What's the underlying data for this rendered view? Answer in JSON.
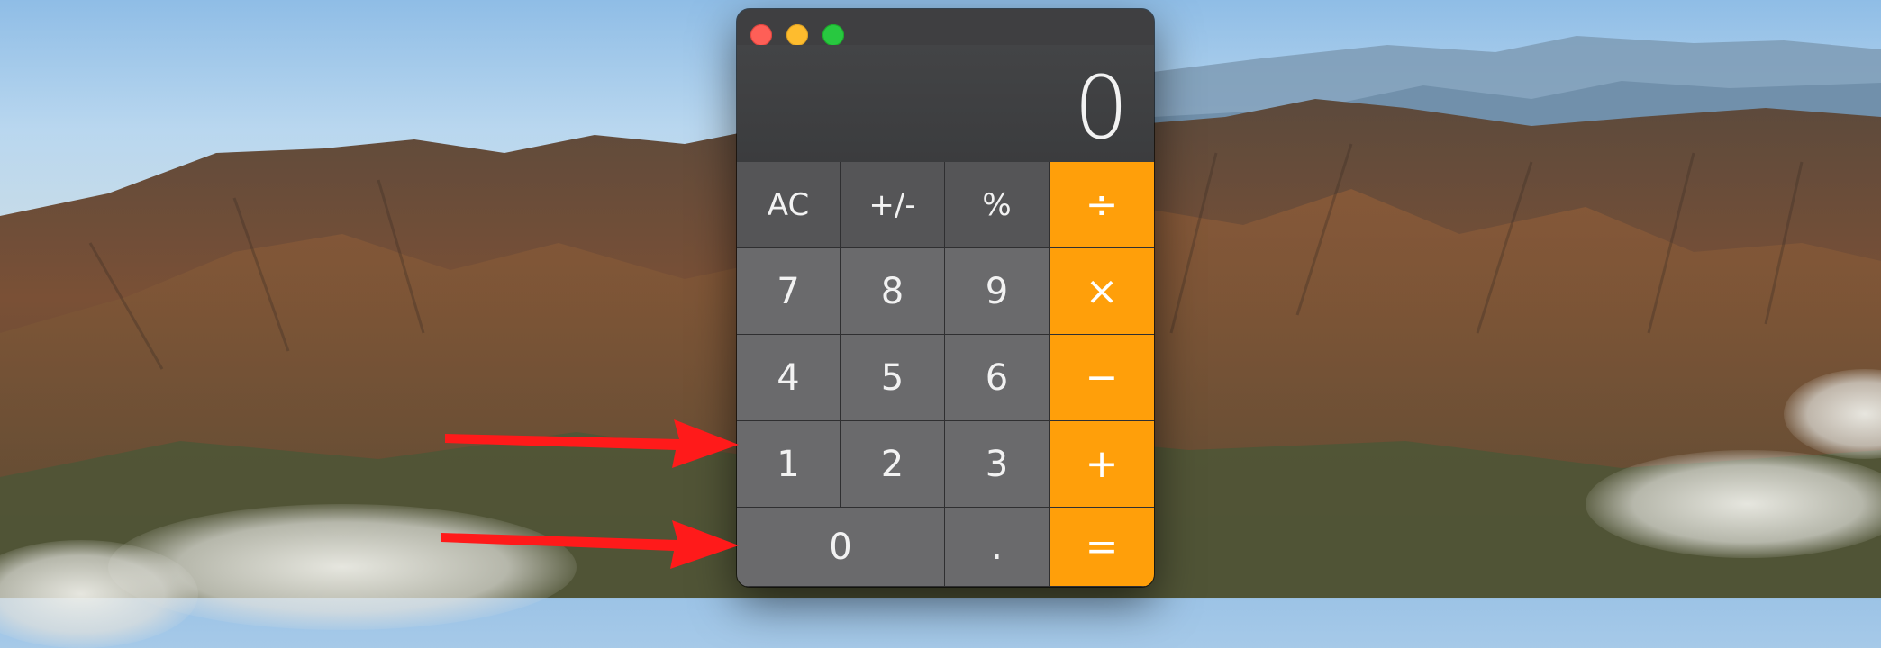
{
  "app": {
    "window_controls": {
      "close": "close",
      "minimize": "minimize",
      "zoom": "zoom"
    },
    "display": {
      "value": "0"
    },
    "keys": {
      "row1": [
        "AC",
        "+/-",
        "%",
        "÷"
      ],
      "row2": [
        "7",
        "8",
        "9",
        "×"
      ],
      "row3": [
        "4",
        "5",
        "6",
        "−"
      ],
      "row4": [
        "1",
        "2",
        "3",
        "+"
      ],
      "row5": [
        "0",
        ".",
        "="
      ]
    }
  },
  "colors": {
    "operator": "#ff9f0a",
    "function_key": "#555557",
    "number_key": "#6a6a6c",
    "annotation_arrow": "#ff1a1a"
  },
  "annotations": {
    "arrows": [
      {
        "points_to": "key-1",
        "icon": "red-arrow-icon"
      },
      {
        "points_to": "key-0",
        "icon": "red-arrow-icon"
      }
    ]
  }
}
